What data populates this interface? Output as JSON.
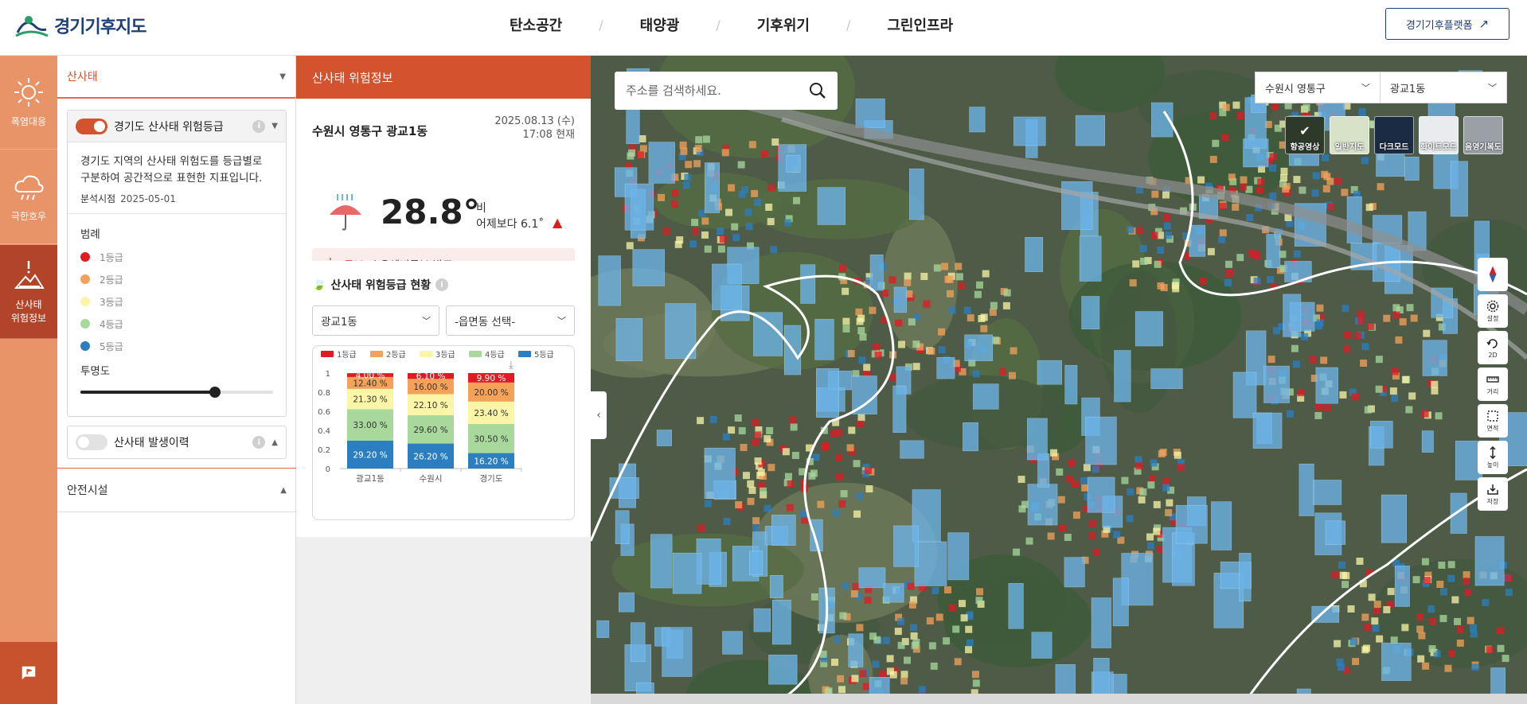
{
  "header": {
    "logo_text": "경기기후지도",
    "nav": [
      "탄소공간",
      "태양광",
      "기후위기",
      "그린인프라"
    ],
    "platform_button": "경기기후플랫폼"
  },
  "rail": {
    "items": [
      {
        "label": "폭염대응",
        "icon": "sun-icon"
      },
      {
        "label": "극한호우",
        "icon": "rain-cloud-icon"
      },
      {
        "label": "산사태\n위험정보",
        "icon": "landslide-icon"
      }
    ],
    "chat_icon": "chat-flag-icon"
  },
  "layer_panel": {
    "category": "산사태",
    "layer": {
      "title": "경기도 산사태 위험등급",
      "description": "경기도 지역의 산사태 위험도를 등급별로 구분하여 공간적으로 표현한 지표입니다.",
      "analysis_label": "분석시점",
      "analysis_date": "2025-05-01",
      "legend_title": "범례",
      "legend": [
        {
          "label": "1등급",
          "color": "#e01b24"
        },
        {
          "label": "2등급",
          "color": "#f4a259"
        },
        {
          "label": "3등급",
          "color": "#fbf5a8"
        },
        {
          "label": "4등급",
          "color": "#a8d89c"
        },
        {
          "label": "5등급",
          "color": "#2b7fc1"
        }
      ],
      "opacity_label": "투명도",
      "opacity": 0.7
    },
    "history_layer": "산사태 발생이력",
    "safety_section": "안전시설"
  },
  "info_panel": {
    "title": "산사태 위험정보",
    "location": "수원시 영통구 광교1동",
    "date": "2025.08.13 (수)",
    "time": "17:08 현재",
    "temperature": "28.8°",
    "condition": "비",
    "compare": "어제보다 6.1˚",
    "alert_tag": "특보",
    "alert_text": "호우예비특보 발표",
    "grade_title": "산사태 위험등급 현황",
    "select_dong": "광교1동",
    "select_emd": "-읍면동 선택-"
  },
  "chart_data": {
    "type": "bar",
    "stacked": true,
    "categories": [
      "광교1동",
      "수원시",
      "경기도"
    ],
    "series": [
      {
        "name": "1등급",
        "color": "#e01b24",
        "values": [
          4.0,
          6.1,
          9.9
        ],
        "labels": [
          "4.00 %",
          "6.10 %",
          "9.90 %"
        ]
      },
      {
        "name": "2등급",
        "color": "#f4a259",
        "values": [
          12.4,
          16.0,
          20.0
        ],
        "labels": [
          "12.40 %",
          "16.00 %",
          "20.00 %"
        ]
      },
      {
        "name": "3등급",
        "color": "#fbf5a8",
        "values": [
          21.3,
          22.1,
          23.4
        ],
        "labels": [
          "21.30 %",
          "22.10 %",
          "23.40 %"
        ]
      },
      {
        "name": "4등급",
        "color": "#a8d89c",
        "values": [
          33.0,
          29.6,
          30.5
        ],
        "labels": [
          "33.00 %",
          "29.60 %",
          "30.50 %"
        ]
      },
      {
        "name": "5등급",
        "color": "#2b7fc1",
        "values": [
          29.2,
          26.2,
          16.2
        ],
        "labels": [
          "29.20 %",
          "26.20 %",
          "16.20 %"
        ]
      }
    ],
    "yticks": [
      "0",
      "0.2",
      "0.4",
      "0.6",
      "0.8",
      "1"
    ],
    "ylim": [
      0,
      1
    ],
    "legend_position": "top",
    "download_icon": "download-icon"
  },
  "map": {
    "search_placeholder": "주소를 검색하세요.",
    "region_select": "수원시 영통구",
    "dong_select": "광교1동",
    "basemaps": [
      "항공영상",
      "일반지도",
      "다크모드",
      "화이트모드",
      "음영기복도"
    ],
    "basemap_active": "항공영상",
    "tools": [
      "설정",
      "2D",
      "거리",
      "면적",
      "높이",
      "저장"
    ]
  }
}
